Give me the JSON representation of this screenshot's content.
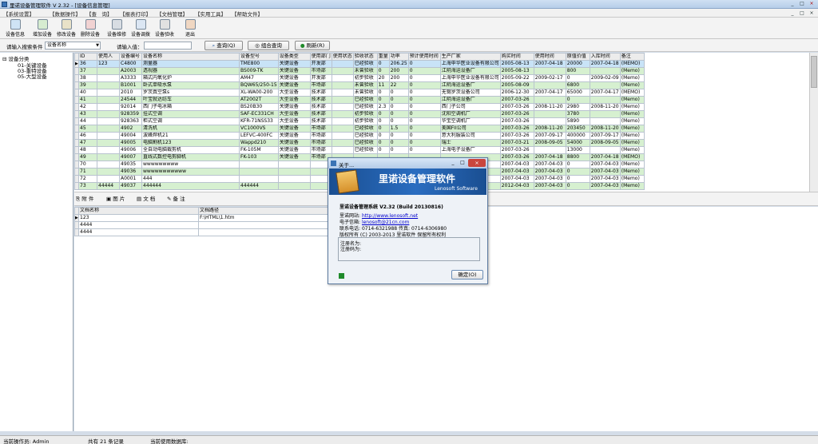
{
  "window": {
    "title": "里诺设备管理软件 V 2.32 - [设备信息管理]",
    "controls": [
      "_",
      "□",
      "×"
    ],
    "doc_controls": [
      "_",
      "□",
      "×"
    ]
  },
  "menu": [
    "【系统设置】",
    "【数据操作】",
    "【查　询】",
    "【报表打印】",
    "【文档管理】",
    "【实用工具】",
    "【帮助文件】"
  ],
  "toolbar": [
    {
      "label": "设备信息",
      "icon": "device-info-icon"
    },
    {
      "label": "增加设备",
      "icon": "add-device-icon"
    },
    {
      "label": "修改设备",
      "icon": "edit-device-icon"
    },
    {
      "label": "删除设备",
      "icon": "delete-device-icon"
    },
    {
      "label": "设备维修",
      "icon": "repair-icon"
    },
    {
      "label": "设备调拨",
      "icon": "transfer-icon"
    },
    {
      "label": "设备验收",
      "icon": "acceptance-icon"
    },
    {
      "label": "退出",
      "icon": "exit-icon"
    }
  ],
  "search": {
    "condition_label": "请输入搜索条件",
    "condition_value": "设备名称",
    "input_label": "请输入值：",
    "input_value": "",
    "query_button": "查询(Q)",
    "combo_button": "组合查询",
    "refresh_button": "刷新(R)"
  },
  "tree": {
    "root": "设备分类",
    "children": [
      "01-关键设备",
      "03-重特设备",
      "05-大型设备"
    ]
  },
  "grid": {
    "columns": [
      "ID",
      "使用人",
      "设备编号",
      "设备名称",
      "设备型号",
      "设备类型",
      "使用部门",
      "使用状态",
      "验收状态",
      "重量",
      "功率",
      "预计使用时间",
      "生产厂家",
      "购买时间",
      "使用时间",
      "原值价值",
      "入库时间",
      "备注"
    ],
    "rows": [
      [
        "36",
        "123",
        "C4800",
        "测量器",
        "TME800",
        "关键设备",
        "开发部",
        "",
        "已经验收",
        "0",
        "206.25",
        "0",
        "上海申华医业设备有限公司",
        "2005-08-13",
        "2007-04-18",
        "20000",
        "2007-04-18",
        "(MEMO)"
      ],
      [
        "37",
        "",
        "A2003",
        "透视器",
        "BS009-TK",
        "关键设备",
        "市场部",
        "",
        "未曾验收",
        "0",
        "200",
        "0",
        "江阴海运设备厂",
        "2005-08-13",
        "",
        "800",
        "",
        "(Memo)"
      ],
      [
        "38",
        "",
        "A3333",
        "箱式内氧化炉",
        "AM47",
        "关键设备",
        "开发部",
        "",
        "初步验收",
        "20",
        "200",
        "0",
        "上海申华医业设备有限公司",
        "2005-09-22",
        "2009-02-17",
        "0",
        "2009-02-09",
        "(Memo)"
      ],
      [
        "39",
        "",
        "B1001",
        "卧式单吸水泵",
        "BQW65/250-15",
        "关键设备",
        "市场部",
        "",
        "未曾验收",
        "11",
        "22",
        "0",
        "江阴海运设备厂",
        "2005-08-09",
        "",
        "6800",
        "",
        "(Memo)"
      ],
      [
        "40",
        "",
        "2010",
        "罗茨真空泵s",
        "XL-WA00-200",
        "大型设备",
        "技术部",
        "",
        "未曾验收",
        "0",
        "0",
        "0",
        "无锡罗茨设备公司",
        "2006-12-30",
        "2007-04-17",
        "65000",
        "2007-04-17",
        "(MEMO)"
      ],
      [
        "41",
        "",
        "24544",
        "叶宝就达纺车",
        "AT2002T",
        "大型设备",
        "技术部",
        "",
        "已经验收",
        "0",
        "0",
        "0",
        "江阴海运设备厂",
        "2007-03-26",
        "",
        "0",
        "",
        "(Memo)"
      ],
      [
        "42",
        "",
        "92014",
        "西门子电冰箱",
        "BS20B30",
        "关键设备",
        "技术部",
        "",
        "已经验收",
        "2.3",
        "0",
        "0",
        "西门子公司",
        "2007-03-26",
        "2008-11-20",
        "2980",
        "2008-11-20",
        "(Memo)"
      ],
      [
        "43",
        "",
        "928359",
        "挂式空调",
        "SAF-EC331CH",
        "大型设备",
        "技术部",
        "",
        "初步验收",
        "0",
        "0",
        "0",
        "沈阳空调机厂",
        "2007-03-26",
        "",
        "3780",
        "",
        "(Memo)"
      ],
      [
        "44",
        "",
        "928363",
        "柜式空调",
        "KFR-71NSS33",
        "大型设备",
        "技术部",
        "",
        "初步验收",
        "0",
        "0",
        "0",
        "华宝空调机厂",
        "2007-03-26",
        "",
        "5890",
        "",
        "(Memo)"
      ],
      [
        "45",
        "",
        "4902",
        "清洗机",
        "VC1000VS",
        "关键设备",
        "市场部",
        "",
        "已经验收",
        "0",
        "1.5",
        "0",
        "美国FII公司",
        "2007-03-26",
        "2008-11-20",
        "203450",
        "2008-11-20",
        "(Memo)"
      ],
      [
        "46",
        "",
        "49004",
        "波峰焊机21",
        "LEFVC-400FC",
        "关键设备",
        "市场部",
        "",
        "已经验收",
        "0",
        "0",
        "0",
        "意大利服装公司",
        "2007-03-26",
        "2007-09-17",
        "400000",
        "2007-09-17",
        "(Memo)"
      ],
      [
        "47",
        "",
        "49005",
        "电脑割机123",
        "Wappd210",
        "关键设备",
        "市场部",
        "",
        "已经验收",
        "0",
        "0",
        "0",
        "瑞士",
        "2007-03-21",
        "2008-09-05",
        "54000",
        "2008-09-05",
        "(Memo)"
      ],
      [
        "48",
        "",
        "49006",
        "全自动电脑裁剪机",
        "FK-105M",
        "关键设备",
        "市场部",
        "",
        "已经验收",
        "0",
        "0",
        "0",
        "上海电子设备厂",
        "2007-03-26",
        "",
        "13000",
        "",
        "(Memo)"
      ],
      [
        "49",
        "",
        "49007",
        "直线式数控电剪脚机",
        "FK-103",
        "关键设备",
        "市场部",
        "",
        "",
        "",
        "",
        "",
        "",
        "2007-03-26",
        "2007-04-18",
        "8800",
        "2007-04-18",
        "(MEMO)"
      ],
      [
        "70",
        "",
        "49035",
        "wwwwwwwww",
        "",
        "",
        "",
        "",
        "",
        "",
        "",
        "",
        "",
        "2007-04-03",
        "2007-04-03",
        "0",
        "2007-04-03",
        "(Memo)"
      ],
      [
        "71",
        "",
        "49036",
        "wwwwwwwwwww",
        "",
        "",
        "",
        "",
        "",
        "",
        "",
        "",
        "",
        "2007-04-03",
        "2007-04-03",
        "0",
        "2007-04-03",
        "(Memo)"
      ],
      [
        "72",
        "",
        "A0001",
        "444",
        "",
        "",
        "",
        "",
        "",
        "",
        "",
        "",
        "",
        "2007-04-03",
        "2007-04-03",
        "0",
        "2007-04-03",
        "(Memo)"
      ],
      [
        "73",
        "44444",
        "49037",
        "444444",
        "444444",
        "",
        "",
        "",
        "",
        "",
        "",
        "",
        "",
        "2012-04-03",
        "2007-04-03",
        "0",
        "2007-04-03",
        "(Memo)"
      ]
    ]
  },
  "attachment_bar": {
    "items": [
      "附 件",
      "图 片",
      "文 档",
      "备 注"
    ]
  },
  "docgrid": {
    "columns": [
      "文档名称",
      "文档路径"
    ],
    "rows": [
      [
        "123",
        "F:\\HTML\\1.htm"
      ],
      [
        "4444",
        ""
      ],
      [
        "4444",
        ""
      ]
    ]
  },
  "status": {
    "operator": "当前操作员: Admin",
    "records": "共有 21 条记录",
    "database": "当前使用数据库:"
  },
  "about": {
    "title": "关于...",
    "banner_title": "里诺设备管理软件",
    "banner_sub": "Lenosoft Software",
    "app_line": "里诺设备管理系统 V2.32 (Build 20130816)",
    "website_label": "里诺网站:",
    "website": "http://www.lenosoft.net",
    "email_label": "电子信箱:",
    "email": "lenosoft@21cn.com",
    "phone_label": "联系电话:",
    "phone": "0714-6321988 传真: 0714-6306980",
    "copyright": "版权所有 (C) 2003-2013 里诺软件 保留所有权利",
    "reg_name": "注册名为:",
    "reg_code": "注册码为:",
    "ok_button": "确定(O)"
  },
  "colors": {
    "row_alt": "#d6f0d0",
    "selected": "#c8e3f7",
    "banner": "#1a4e91",
    "titlebar": "#b6cde8"
  }
}
